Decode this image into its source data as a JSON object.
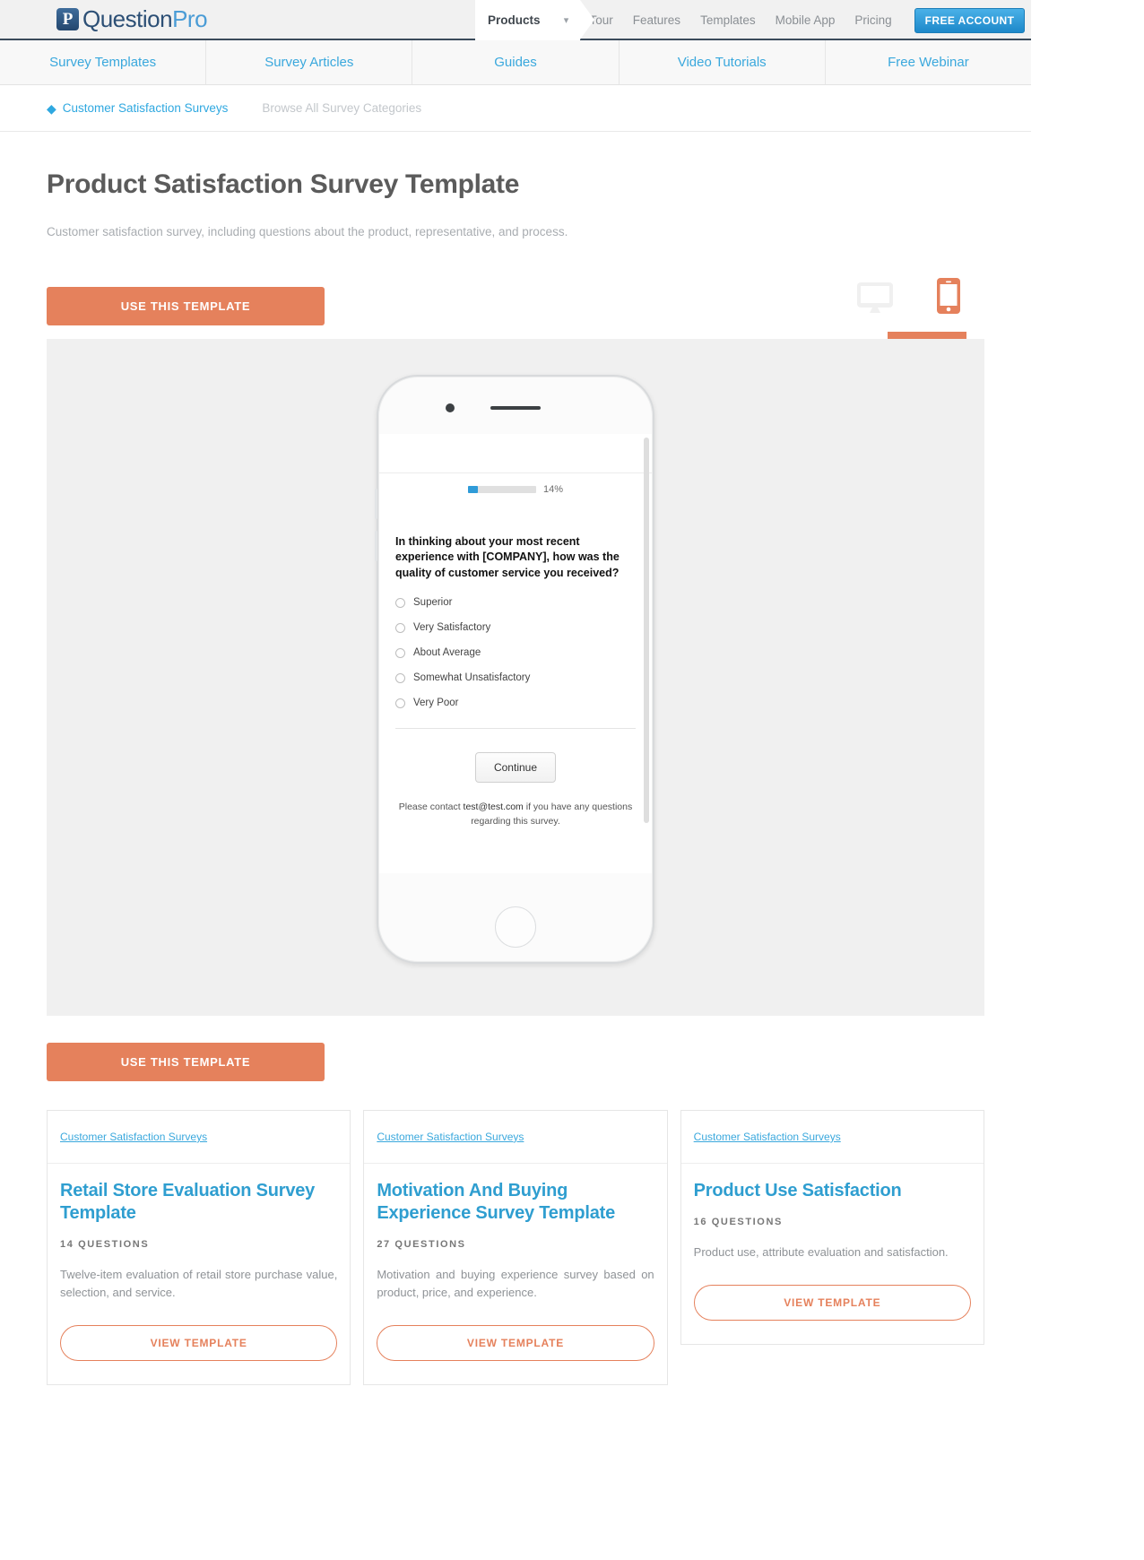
{
  "brand": {
    "logo_mark": "P",
    "name_part1": "Question",
    "name_part2": "Pro"
  },
  "topnav": {
    "products_label": "Products",
    "caret_icon": "chevron-down-icon",
    "items": [
      "Tour",
      "Features",
      "Templates",
      "Mobile App",
      "Pricing"
    ],
    "cta_label": "FREE ACCOUNT",
    "cta_color": "#2b9ad6"
  },
  "subnav": {
    "items": [
      "Survey Templates",
      "Survey Articles",
      "Guides",
      "Video Tutorials",
      "Free Webinar"
    ]
  },
  "breadcrumb": {
    "back_icon": "back-chevron-icon",
    "current": "Customer Satisfaction Surveys",
    "browse_all": "Browse All Survey Categories"
  },
  "header": {
    "title": "Product Satisfaction Survey Template",
    "description": "Customer satisfaction survey, including questions about the product, representative, and process."
  },
  "actions": {
    "use_template_top": "USE THIS TEMPLATE",
    "use_template_bottom": "USE THIS TEMPLATE",
    "accent_color": "#e5815c",
    "desktop_icon": "desktop-monitor-icon",
    "mobile_icon": "mobile-phone-icon",
    "active_device": "mobile"
  },
  "preview": {
    "progress_percent": "14%",
    "progress_value": 14,
    "progress_color": "#2f9bd8",
    "question": "In thinking about your most recent experience with [COMPANY], how was the quality of customer service you received?",
    "options": [
      "Superior",
      "Very Satisfactory",
      "About Average",
      "Somewhat Unsatisfactory",
      "Very Poor"
    ],
    "continue_label": "Continue",
    "footer_pre": "Please contact ",
    "footer_email": "test@test.com",
    "footer_post": " if you have any questions regarding this survey."
  },
  "cards": [
    {
      "category": "Customer Satisfaction Surveys",
      "title": "Retail Store Evaluation Survey Template",
      "count": "14 QUESTIONS",
      "description": "Twelve-item evaluation of retail store purchase value, selection, and service.",
      "button": "VIEW TEMPLATE"
    },
    {
      "category": "Customer Satisfaction Surveys",
      "title": "Motivation And Buying Experience Survey Template",
      "count": "27 QUESTIONS",
      "description": "Motivation and buying experience survey based on product, price, and experience.",
      "button": "VIEW TEMPLATE"
    },
    {
      "category": "Customer Satisfaction Surveys",
      "title": "Product Use Satisfaction",
      "count": "16 QUESTIONS",
      "description": "Product use, attribute evaluation and satisfaction.",
      "button": "VIEW TEMPLATE"
    }
  ]
}
